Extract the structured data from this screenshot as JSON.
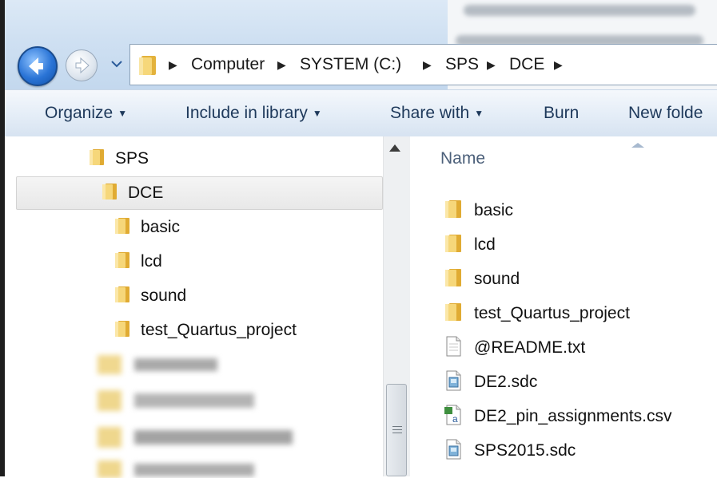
{
  "address_bar": {
    "crumbs": [
      "Computer",
      "SYSTEM (C:)",
      "SPS",
      "DCE"
    ]
  },
  "command_bar": {
    "organize": "Organize",
    "include_in_library": "Include in library",
    "share_with": "Share with",
    "burn": "Burn",
    "new_folder": "New folde"
  },
  "nav_tree": {
    "items": [
      "SPS",
      "DCE",
      "basic",
      "lcd",
      "sound",
      "test_Quartus_project"
    ]
  },
  "content": {
    "column_name": "Name",
    "files": [
      {
        "name": "basic",
        "icon": "folder-icon"
      },
      {
        "name": "lcd",
        "icon": "folder-icon"
      },
      {
        "name": "sound",
        "icon": "folder-icon"
      },
      {
        "name": "test_Quartus_project",
        "icon": "folder-icon"
      },
      {
        "name": "@README.txt",
        "icon": "text-file-icon"
      },
      {
        "name": "DE2.sdc",
        "icon": "sdc-file-icon"
      },
      {
        "name": "DE2_pin_assignments.csv",
        "icon": "csv-file-icon"
      },
      {
        "name": "SPS2015.sdc",
        "icon": "sdc-file-icon"
      }
    ]
  },
  "colors": {
    "command_text": "#1e395b",
    "folder_yellow": "#f2c94c",
    "nav_back_blue": "#2a74d6"
  }
}
